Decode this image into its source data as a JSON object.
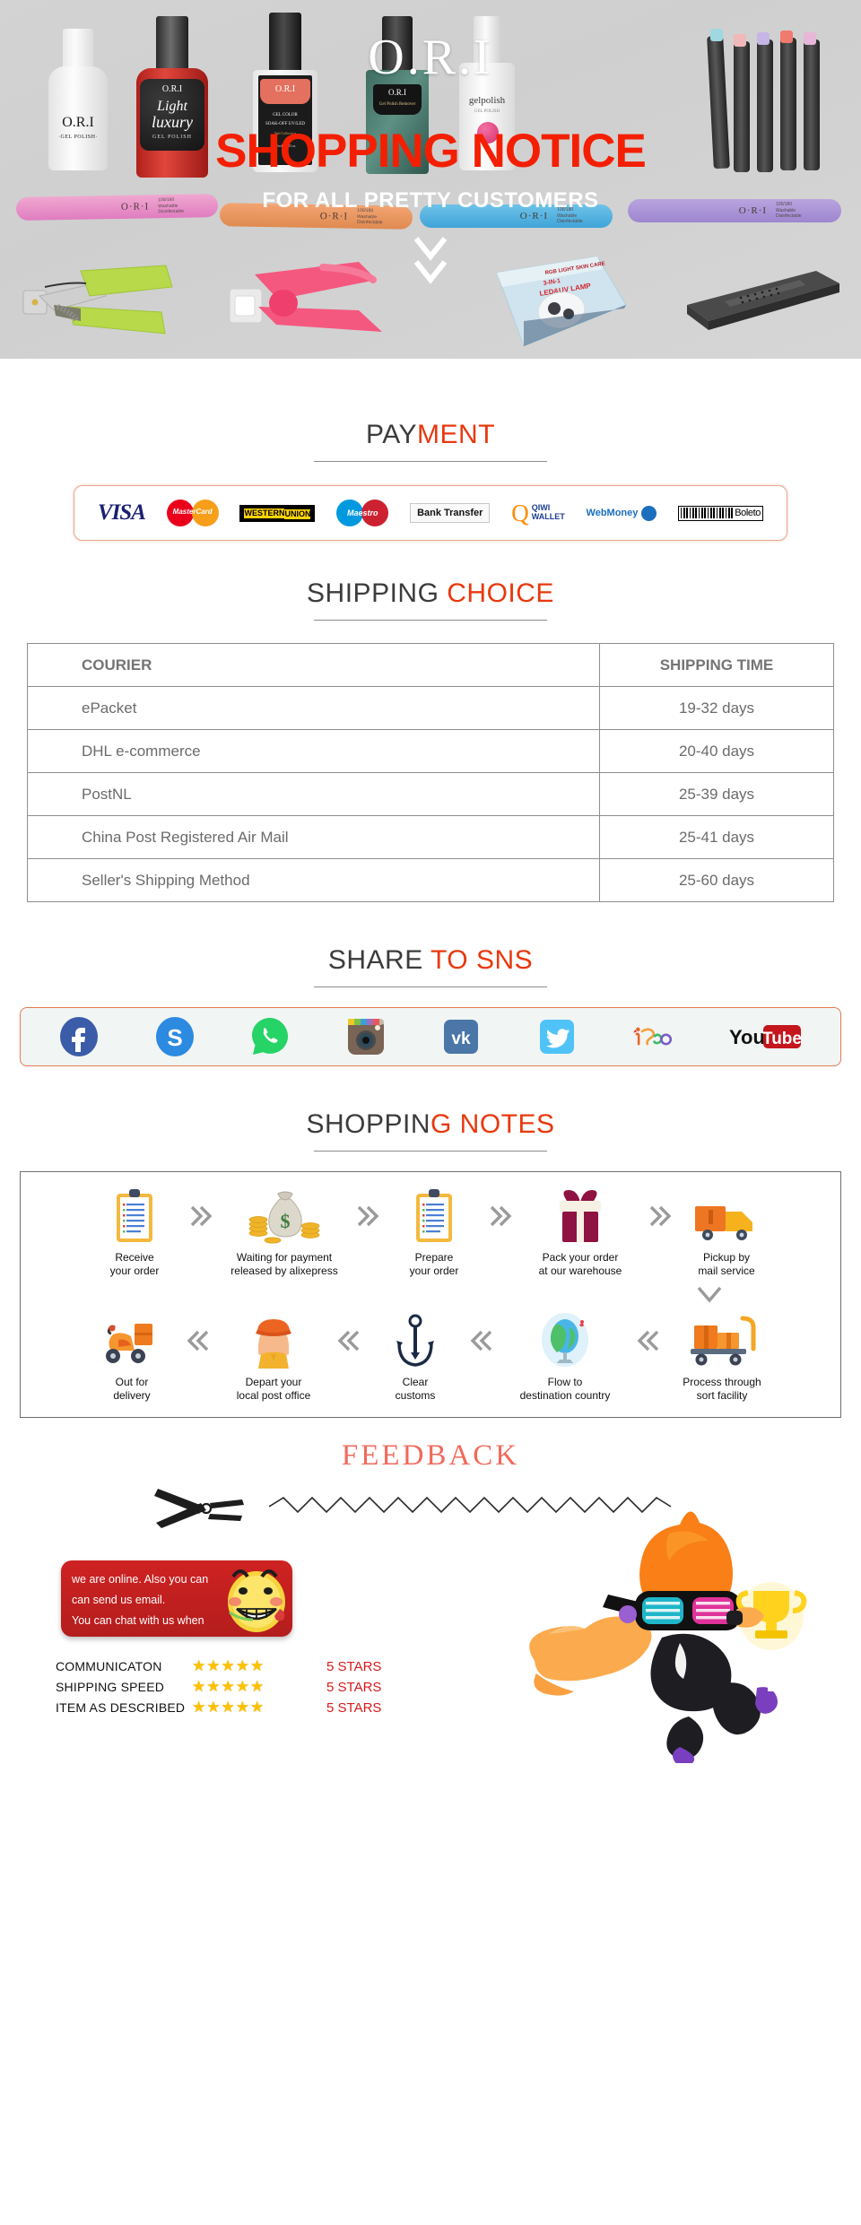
{
  "hero": {
    "brand": "O.R.I",
    "title": "SHOPPING NOTICE",
    "subtitle": "FOR ALL PRETTY CUSTOMERS",
    "chevron_icon": "double-chevron-down-icon",
    "bottle_labels": [
      "O.R.I",
      "O.R.I",
      "O.R.I",
      "O.R.I",
      "O.R.I"
    ],
    "bottle_sublabels": [
      "GEL POLISH",
      "GEL POLISH",
      "SOAK-OFF UV/LED",
      "Gel Polish Remover",
      "gelpolish"
    ],
    "file_label": "O·R·I",
    "file_sub": "100/180\nWashable\nDisinfectable",
    "colors": {
      "title": "#f41f00",
      "brand": "#ffffff",
      "background": "#d3d3d3"
    }
  },
  "payment": {
    "title_dark": "PAY",
    "title_accent": "MENT",
    "methods": [
      {
        "name": "visa",
        "label": "VISA"
      },
      {
        "name": "mastercard",
        "label": "MasterCard"
      },
      {
        "name": "western-union",
        "label_top": "WESTERN",
        "label_bottom": "UNION"
      },
      {
        "name": "maestro",
        "label": "Maestro"
      },
      {
        "name": "bank-transfer",
        "label": "Bank Transfer"
      },
      {
        "name": "qiwi-wallet",
        "label_top": "QIWI",
        "label_bottom": "WALLET",
        "mark": "Q"
      },
      {
        "name": "webmoney",
        "label": "WebMoney"
      },
      {
        "name": "boleto",
        "label": "Boleto"
      }
    ]
  },
  "shipping": {
    "title_dark": "SHIPPING",
    "title_accent": "CHOICE",
    "headers": [
      "COURIER",
      "SHIPPING TIME"
    ],
    "rows": [
      {
        "courier": "ePacket",
        "time": "19-32 days"
      },
      {
        "courier": "DHL e-commerce",
        "time": "20-40 days"
      },
      {
        "courier": "PostNL",
        "time": "25-39 days"
      },
      {
        "courier": "China Post Registered Air Mail",
        "time": "25-41 days"
      },
      {
        "courier": "Seller's Shipping Method",
        "time": "25-60 days"
      }
    ]
  },
  "sns": {
    "title_dark": "SHARE",
    "title_accent": "TO SNS",
    "icons": [
      {
        "name": "facebook-icon",
        "label": "f"
      },
      {
        "name": "skype-icon",
        "label": "S"
      },
      {
        "name": "whatsapp-icon",
        "label": "phone"
      },
      {
        "name": "instagram-icon",
        "label": "camera"
      },
      {
        "name": "vk-icon",
        "label": "vk"
      },
      {
        "name": "twitter-icon",
        "label": "bird"
      },
      {
        "name": "itao-icon",
        "label": "iTao"
      },
      {
        "name": "youtube-icon",
        "label_left": "You",
        "label_right": "Tube"
      }
    ]
  },
  "notes": {
    "title_dark": "SHOPPIN",
    "title_accent": "G NOTES",
    "row1": [
      {
        "icon": "clipboard-icon",
        "label": "Receive\nyour order"
      },
      {
        "icon": "money-bag-icon",
        "label": "Waiting for payment\nreleased by alixepress"
      },
      {
        "icon": "clipboard-icon",
        "label": "Prepare\nyour order"
      },
      {
        "icon": "gift-box-icon",
        "label": "Pack your order\nat our warehouse"
      },
      {
        "icon": "delivery-truck-icon",
        "label": "Pickup by\nmail service"
      }
    ],
    "row2": [
      {
        "icon": "scooter-icon",
        "label": "Out for\ndelivery"
      },
      {
        "icon": "postman-icon",
        "label": "Depart your\nlocal post office"
      },
      {
        "icon": "anchor-icon",
        "label": "Clear\ncustoms"
      },
      {
        "icon": "globe-icon",
        "label": "Flow to\ndestination country"
      },
      {
        "icon": "cargo-cart-icon",
        "label": "Process through\nsort facility"
      }
    ],
    "arrow_right_icon": "double-chevron-right-icon",
    "arrow_left_icon": "double-chevron-left-icon",
    "arrow_down_icon": "chevron-down-icon"
  },
  "feedback": {
    "title": "FEEDBACK",
    "scissors_icon": "scissors-icon",
    "chat_lines": [
      "we are online. Also you can",
      "can send us email.",
      "You can chat with us when"
    ],
    "emoji_icon": "grinning-face-icon",
    "mascot_icon": "orange-mascot-icon",
    "ratings": [
      {
        "label": "COMMUNICATON",
        "stars": 5,
        "value": "5 STARS"
      },
      {
        "label": "SHIPPING SPEED",
        "stars": 5,
        "value": "5 STARS"
      },
      {
        "label": "ITEM AS DESCRIBED",
        "stars": 5,
        "value": "5 STARS"
      }
    ],
    "star_icon": "star-icon",
    "colors": {
      "bubble": "#c51f1f",
      "value": "#d71a1a",
      "title": "#f06a5c"
    }
  }
}
